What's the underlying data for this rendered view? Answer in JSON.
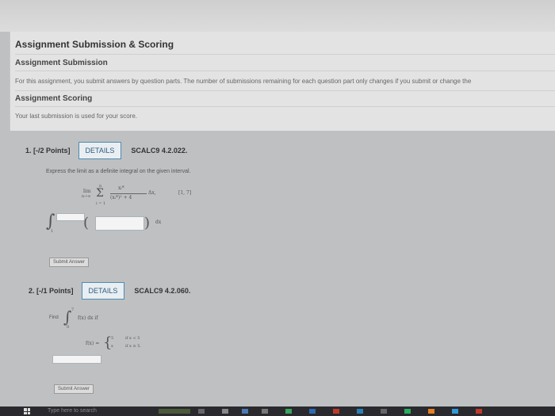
{
  "header": {
    "title": "Assignment Submission & Scoring",
    "submission_heading": "Assignment Submission",
    "submission_text": "For this assignment, you submit answers by question parts. The number of submissions remaining for each question part only changes if you submit or change the",
    "scoring_heading": "Assignment Scoring",
    "scoring_text": "Your last submission is used for your score."
  },
  "questions": [
    {
      "number": "1.",
      "points": "[-/2 Points]",
      "details_label": "DETAILS",
      "code": "SCALC9 4.2.022.",
      "prompt": "Express the limit as a definite integral on the given interval.",
      "lim": "lim",
      "limsub": "n→∞",
      "sum_top": "n",
      "sum_bottom": "i = 1",
      "numerator": "xᵢ*",
      "denominator": "(xᵢ*)² + 4",
      "delta": "Δx,",
      "interval": "[1, 7]",
      "integral_lower": "1",
      "dx": "dx",
      "submit_label": "Submit Answer"
    },
    {
      "number": "2.",
      "points": "[-/1 Points]",
      "details_label": "DETAILS",
      "code": "SCALC9 4.2.060.",
      "find_label": "Find",
      "integral_upper": "7",
      "integral_lower": "0",
      "integrand": "f(x) dx  if",
      "fx_label": "f(x) =",
      "case1_val": "5",
      "case1_cond": "if x < 5",
      "case2_val": "x",
      "case2_cond": "if x ≥ 5.",
      "submit_label": "Submit Answer"
    }
  ],
  "taskbar": {
    "search_placeholder": "Type here to search"
  },
  "colors": {
    "details_border": "#4d8bb0",
    "taskbar": "#2a2a2e"
  }
}
